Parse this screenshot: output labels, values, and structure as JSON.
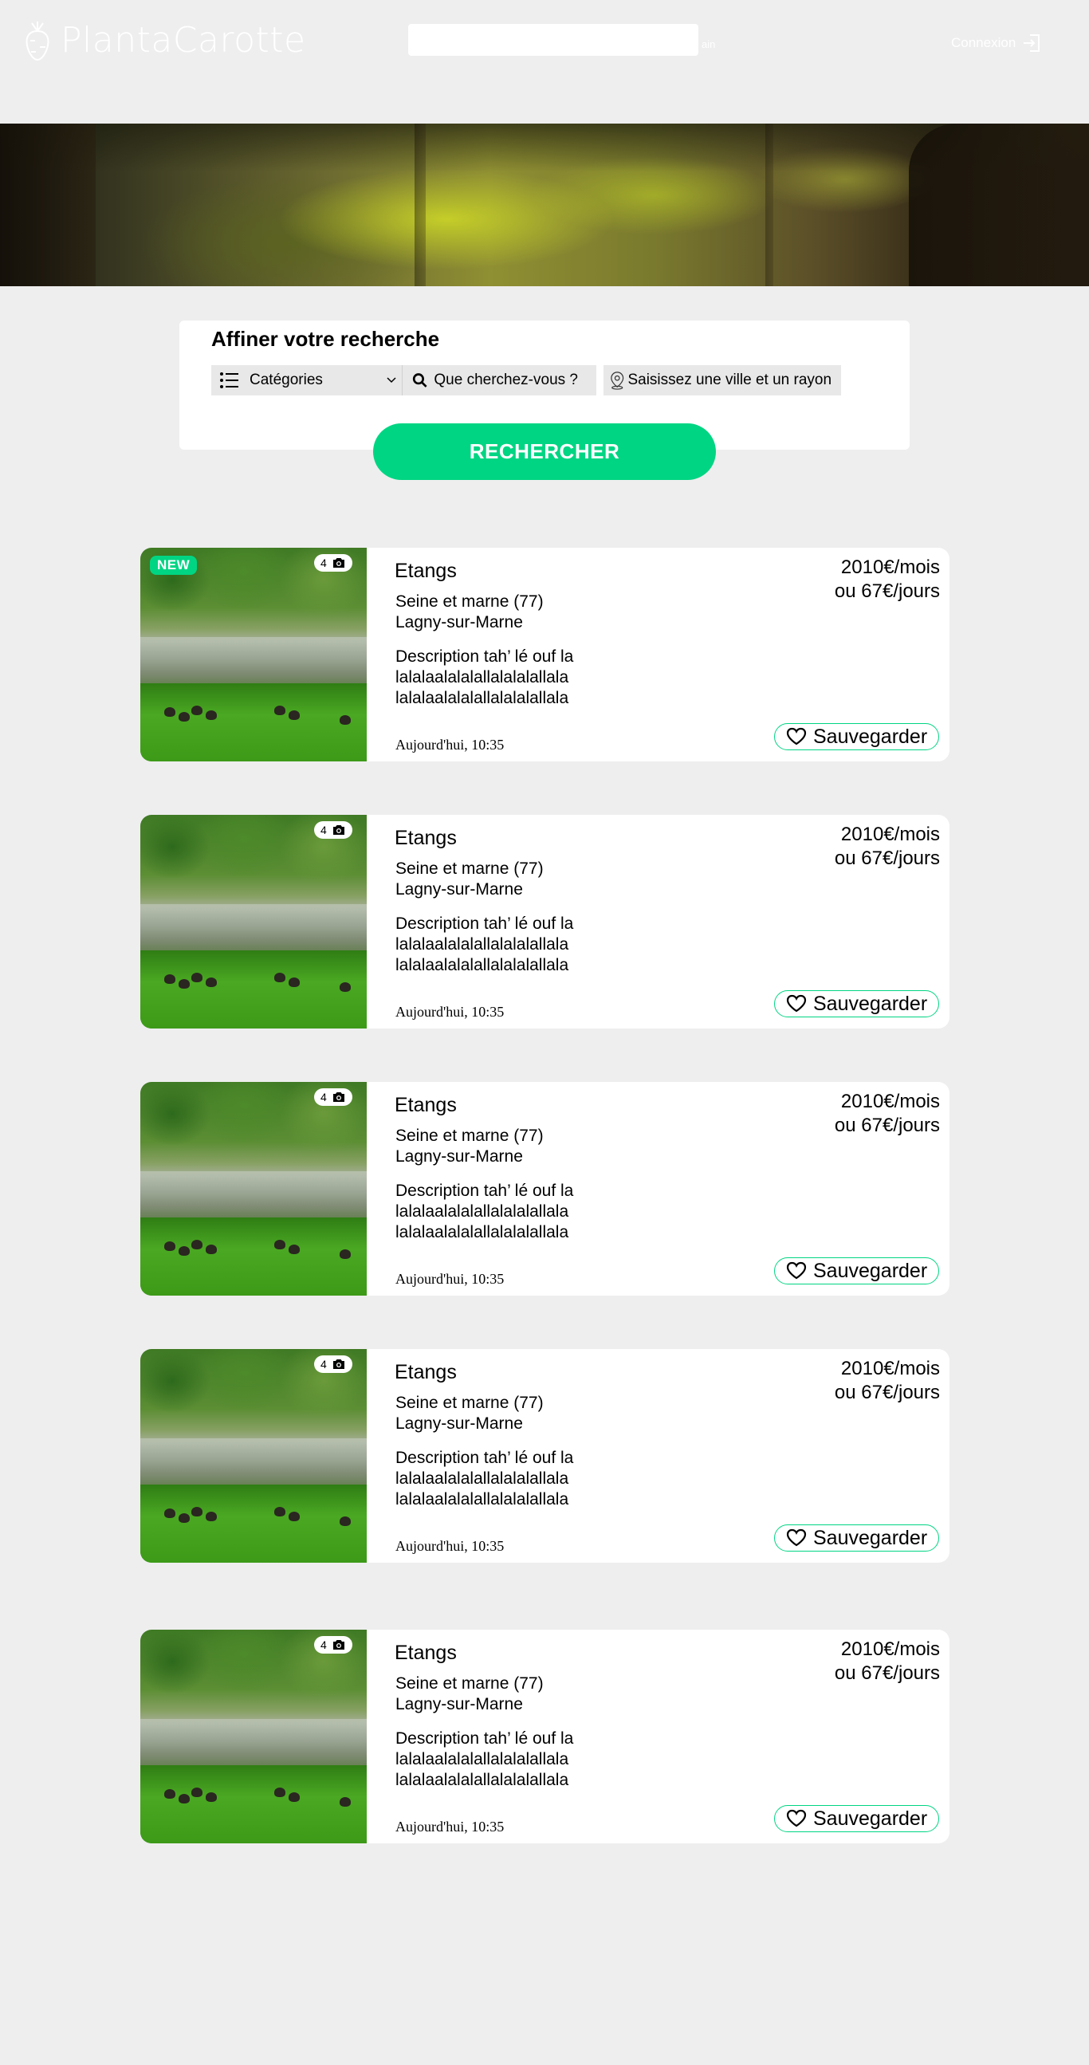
{
  "header": {
    "brand": "PlantaCarotte",
    "search_suffix": "ain",
    "login_label": "Connexion",
    "search_value": ""
  },
  "filter": {
    "title": "Affiner votre recherche",
    "category_label": "Catégories",
    "what_placeholder": "Que cherchez-vous ?",
    "where_placeholder": "Saisissez une ville et un rayon",
    "search_button": "RECHERCHER"
  },
  "colors": {
    "accent": "#00d583",
    "background": "#eeeeee"
  },
  "listings": [
    {
      "badge": "NEW",
      "photo_count": "4",
      "title": "Etangs",
      "region": "Seine et marne (77)",
      "city": "Lagny-sur-Marne",
      "description": "Description tah’ lé ouf la lalalaalalalallalalalallala lalalaalalalallalalalallala",
      "price_month": "2010€/mois",
      "price_day": "ou 67€/jours",
      "date": "Aujourd'hui, 10:35",
      "save_label": "Sauvegarder"
    },
    {
      "badge": "",
      "photo_count": "4",
      "title": "Etangs",
      "region": "Seine et marne (77)",
      "city": "Lagny-sur-Marne",
      "description": "Description tah’ lé ouf la lalalaalalalallalalalallala lalalaalalalallalalalallala",
      "price_month": "2010€/mois",
      "price_day": "ou 67€/jours",
      "date": "Aujourd'hui, 10:35",
      "save_label": "Sauvegarder"
    },
    {
      "badge": "",
      "photo_count": "4",
      "title": "Etangs",
      "region": "Seine et marne (77)",
      "city": "Lagny-sur-Marne",
      "description": "Description tah’ lé ouf la lalalaalalalallalalalallala lalalaalalalallalalalallala",
      "price_month": "2010€/mois",
      "price_day": "ou 67€/jours",
      "date": "Aujourd'hui, 10:35",
      "save_label": "Sauvegarder"
    },
    {
      "badge": "",
      "photo_count": "4",
      "title": "Etangs",
      "region": "Seine et marne (77)",
      "city": "Lagny-sur-Marne",
      "description": "Description tah’ lé ouf la lalalaalalalallalalalallala lalalaalalalallalalalallala",
      "price_month": "2010€/mois",
      "price_day": "ou 67€/jours",
      "date": "Aujourd'hui, 10:35",
      "save_label": "Sauvegarder"
    },
    {
      "badge": "",
      "photo_count": "4",
      "title": "Etangs",
      "region": "Seine et marne (77)",
      "city": "Lagny-sur-Marne",
      "description": "Description tah’ lé ouf la lalalaalalalallalalalallala lalalaalalalallalalalallala",
      "price_month": "2010€/mois",
      "price_day": "ou 67€/jours",
      "date": "Aujourd'hui, 10:35",
      "save_label": "Sauvegarder"
    }
  ]
}
